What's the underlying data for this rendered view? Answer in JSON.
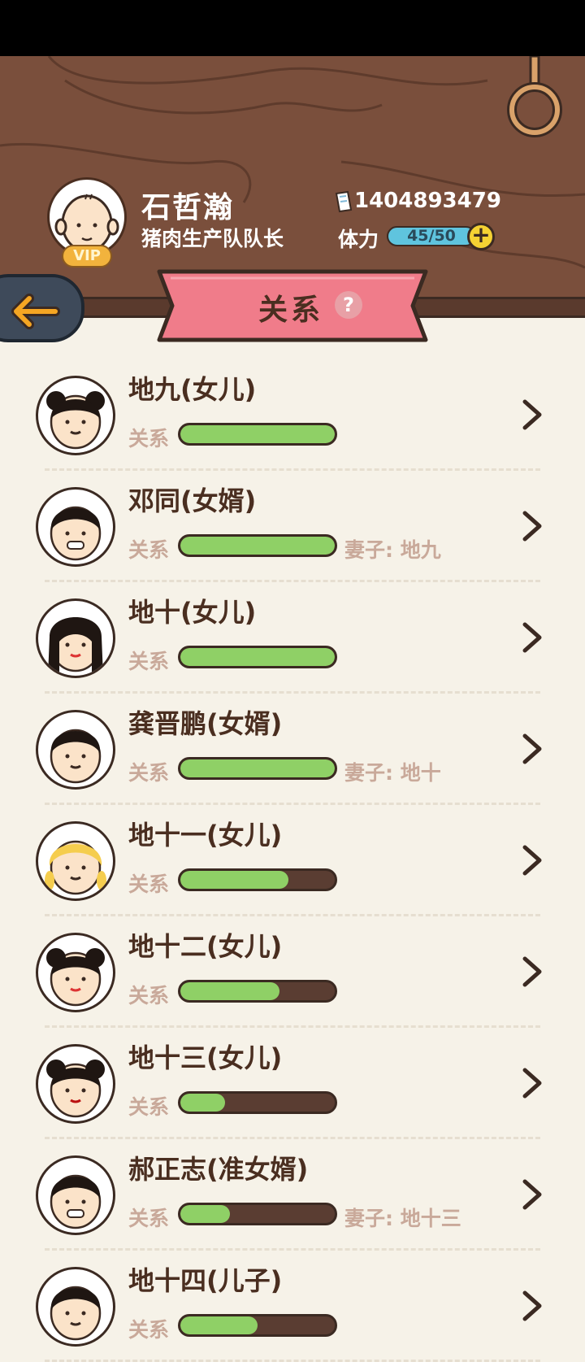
{
  "player": {
    "name": "石哲瀚",
    "title": "猪肉生产队队长",
    "vip": "VIP",
    "money": "1404893479",
    "stamina_label": "体力",
    "stamina": "45/50",
    "stamina_plus": "+"
  },
  "page": {
    "title": "关系",
    "help": "?",
    "back_icon": "back-arrow-icon"
  },
  "relation_label": "关系",
  "rows": [
    {
      "name": "地九(女儿)",
      "level": 1.0,
      "spouse": ""
    },
    {
      "name": "邓同(女婿)",
      "level": 1.0,
      "spouse": "妻子: 地九"
    },
    {
      "name": "地十(女儿)",
      "level": 1.0,
      "spouse": ""
    },
    {
      "name": "龚晋鹏(女婿)",
      "level": 1.0,
      "spouse": "妻子: 地十"
    },
    {
      "name": "地十一(女儿)",
      "level": 0.7,
      "spouse": ""
    },
    {
      "name": "地十二(女儿)",
      "level": 0.64,
      "spouse": ""
    },
    {
      "name": "地十三(女儿)",
      "level": 0.29,
      "spouse": ""
    },
    {
      "name": "郝正志(准女婿)",
      "level": 0.32,
      "spouse": "妻子: 地十三"
    },
    {
      "name": "地十四(儿子)",
      "level": 0.5,
      "spouse": ""
    }
  ],
  "colors": {
    "wood": "#7a4f3c",
    "banner": "#f07c8a",
    "bar_fill": "#8fd066",
    "background": "#f6f2e8"
  }
}
